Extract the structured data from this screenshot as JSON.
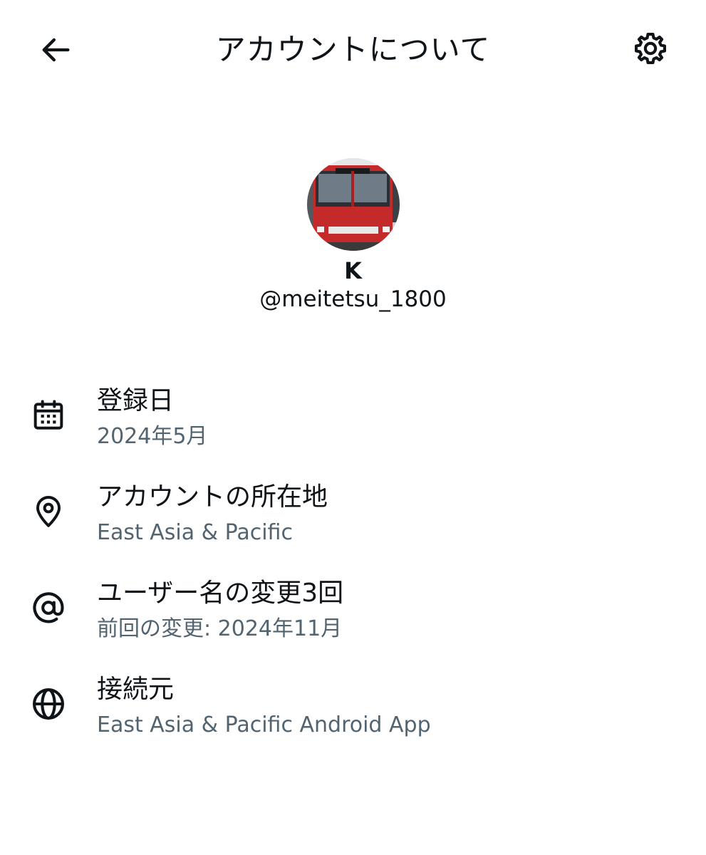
{
  "header": {
    "title": "アカウントについて",
    "back_icon": "arrow-left-icon",
    "settings_icon": "gear-icon"
  },
  "profile": {
    "display_name": "K",
    "handle": "@meitetsu_1800"
  },
  "info": [
    {
      "icon": "calendar-icon",
      "label": "登録日",
      "value": "2024年5月"
    },
    {
      "icon": "location-pin-icon",
      "label": "アカウントの所在地",
      "value": "East Asia & Pacific"
    },
    {
      "icon": "at-sign-icon",
      "label": "ユーザー名の変更3回",
      "value": "前回の変更: 2024年11月"
    },
    {
      "icon": "globe-icon",
      "label": "接続元",
      "value": "East Asia & Pacific Android App"
    }
  ],
  "colors": {
    "text_primary": "#0f1419",
    "text_secondary": "#536471",
    "background": "#ffffff"
  }
}
